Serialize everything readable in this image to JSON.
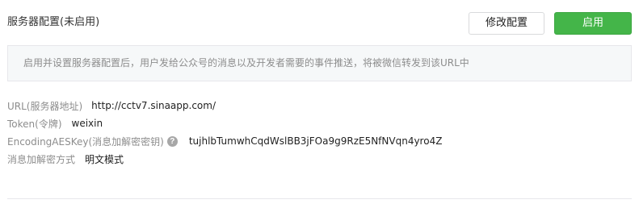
{
  "header": {
    "title": "服务器配置(未启用)"
  },
  "buttons": {
    "modify_label": "修改配置",
    "enable_label": "启用"
  },
  "notice": {
    "text": "启用并设置服务器配置后，用户发给公众号的消息以及开发者需要的事件推送，将被微信转发到该URL中"
  },
  "fields": [
    {
      "label": "URL(服务器地址)",
      "value": "http://cctv7.sinaapp.com/"
    },
    {
      "label": "Token(令牌)",
      "value": "weixin"
    },
    {
      "label": "EncodingAESKey(消息加解密密钥)",
      "value": "tujhlbTumwhCqdWslBB3jFOa9g9RzE5NfNVqn4yro4Z",
      "help_icon": "question-mark-icon",
      "help_glyph": "?"
    },
    {
      "label": "消息加解密方式",
      "value": "明文模式"
    }
  ],
  "colors": {
    "accent_green": "#44b549",
    "notice_bg": "#f6f8f9",
    "label_gray": "#8d8d8d"
  }
}
